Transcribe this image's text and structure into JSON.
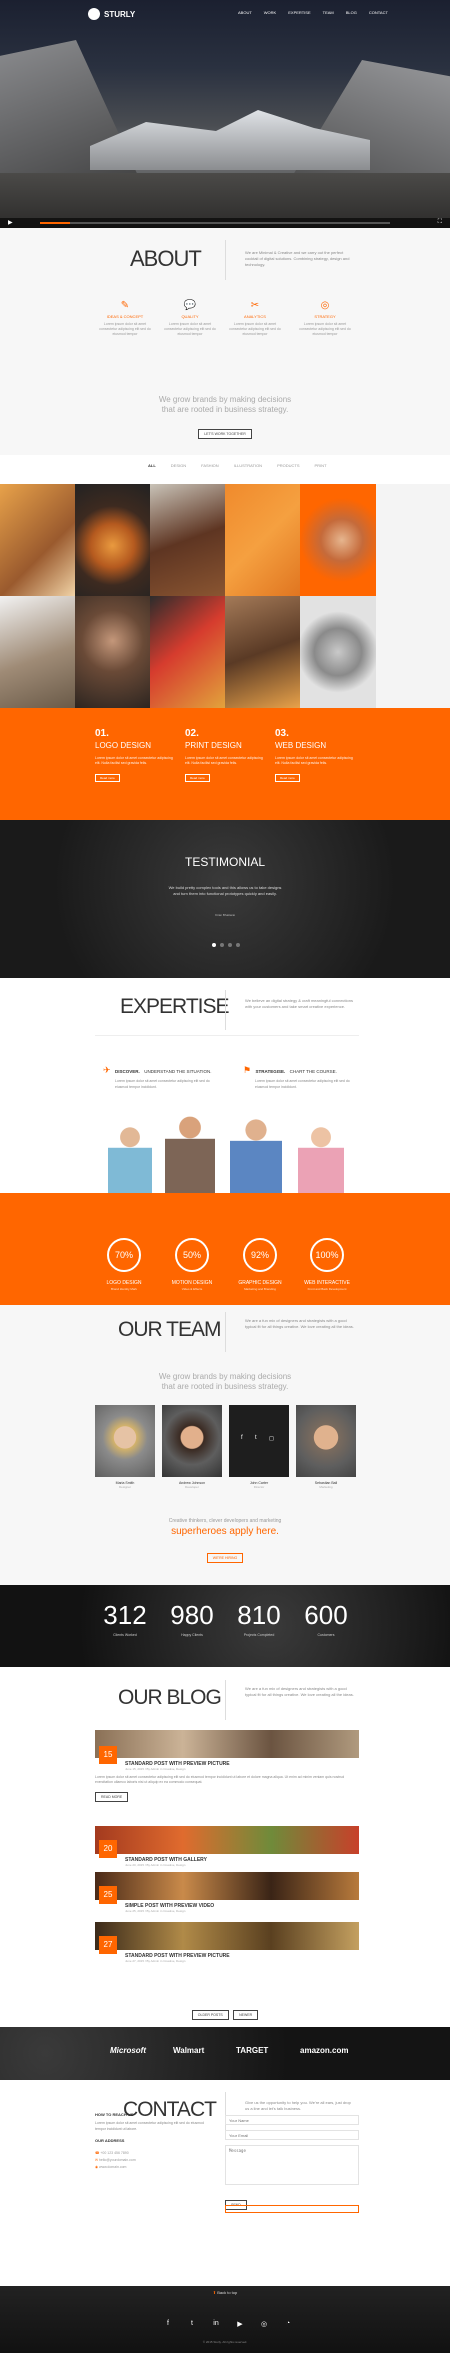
{
  "header": {
    "logo": "STURLY",
    "nav": [
      "About",
      "Work",
      "Expertise",
      "Team",
      "Blog",
      "Contact"
    ]
  },
  "about": {
    "title": "ABOUT",
    "intro": "We are Minimal & Creative and we carry out the perfect cocktail of digital solutions. Combining strategy, design and technology.",
    "features": [
      {
        "icon": "pencil-icon",
        "title": "Ideas & Concept",
        "desc": "Lorem ipsum dolor sit amet consectetur adipiscing elit sed do eiusmod tempor"
      },
      {
        "icon": "chat-icon",
        "title": "Quality",
        "desc": "Lorem ipsum dolor sit amet consectetur adipiscing elit sed do eiusmod tempor"
      },
      {
        "icon": "scissors-icon",
        "title": "Analytics",
        "desc": "Lorem ipsum dolor sit amet consectetur adipiscing elit sed do eiusmod tempor"
      },
      {
        "icon": "target-icon",
        "title": "Strategy",
        "desc": "Lorem ipsum dolor sit amet consectetur adipiscing elit sed do eiusmod tempor"
      }
    ],
    "tagline_1": "We grow brands by making decisions",
    "tagline_2": "that are rooted in business strategy.",
    "button": "Let's work together"
  },
  "portfolio": {
    "tabs": [
      "All",
      "Design",
      "Fashion",
      "Illustration",
      "Products",
      "Print"
    ]
  },
  "services": [
    {
      "num": "01.",
      "title": "LOGO DESIGN",
      "desc": "Lorem ipsum dolor sit amet consectetur adipiscing elit. Nulla facilisi sed gravida felis.",
      "btn": "Read more"
    },
    {
      "num": "02.",
      "title": "PRINT DESIGN",
      "desc": "Lorem ipsum dolor sit amet consectetur adipiscing elit. Nulla facilisi sed gravida felis.",
      "btn": "Read more"
    },
    {
      "num": "03.",
      "title": "WEB DESIGN",
      "desc": "Lorem ipsum dolor sit amet consectetur adipiscing elit. Nulla facilisi sed gravida felis.",
      "btn": "Read more"
    }
  ],
  "testimonial": {
    "title": "TESTIMONIAL",
    "quote": "We build pretty complex tools and this allows us to take designs and turn them into functional prototypes quickly and easily.",
    "author": "Kiran Bhattarai"
  },
  "expertise": {
    "title": "EXPERTISE",
    "intro": "We believe an digital strategy & craft meaningful connections with your customers and take smart creative experience.",
    "items": [
      {
        "icon": "plane-icon",
        "title": "DISCOVER.",
        "sub": "UNDERSTAND THE SITUATION.",
        "desc": "Lorem ipsum dolor sit amet consectetur adipiscing elit sed do eiusmod tempor incididunt."
      },
      {
        "icon": "flag-icon",
        "title": "STRATEGISE.",
        "sub": "CHART THE COURSE.",
        "desc": "Lorem ipsum dolor sit amet consectetur adipiscing elit sed do eiusmod tempor incididunt."
      }
    ]
  },
  "skills": [
    {
      "value": "70%",
      "title": "Logo Design",
      "desc": "Brand Identity Mark"
    },
    {
      "value": "50%",
      "title": "Motion Design",
      "desc": "Video & Effects"
    },
    {
      "value": "92%",
      "title": "Graphic Design",
      "desc": "Marketing and Branding"
    },
    {
      "value": "100%",
      "title": "Web Interactive",
      "desc": "Front and Back Development"
    }
  ],
  "team": {
    "title": "OUR TEAM",
    "intro": "We are a fun mix of designers and strategists with a good typical fit for all things creative. We love creating all the ideas.",
    "tagline_1": "We grow brands by making decisions",
    "tagline_2": "that are rooted in business strategy.",
    "members": [
      {
        "name": "Maria Smith",
        "role": "Designer"
      },
      {
        "name": "Andrew Johnson",
        "role": "Developer"
      },
      {
        "name": "John Carter",
        "role": "Director"
      },
      {
        "name": "Sebastian Ball",
        "role": "Marketing"
      }
    ],
    "hiring_1": "Creative thinkers, clever developers and marketing",
    "hiring_2": "superheroes apply here.",
    "hiring_btn": "We're hiring"
  },
  "counters": [
    {
      "value": "312",
      "label": "Clients Worked"
    },
    {
      "value": "980",
      "label": "Happy Clients"
    },
    {
      "value": "810",
      "label": "Projects Completed"
    },
    {
      "value": "600",
      "label": "Customers"
    }
  ],
  "blog": {
    "title": "OUR BLOG",
    "intro": "We are a fun mix of designers and strategists with a good typical fit for all things creative. We love creating all the ideas.",
    "posts": [
      {
        "day": "15",
        "title": "STANDARD POST WITH PREVIEW PICTURE",
        "meta": "June 15, 2015 / By Admin in Creative, Design"
      },
      {
        "day": "20",
        "title": "STANDARD POST WITH GALLERY",
        "meta": "June 20, 2015 / By Admin in Creative, Design"
      },
      {
        "day": "25",
        "title": "SIMPLE POST WITH PREVIEW VIDEO",
        "meta": "June 25, 2015 / By Admin in Creative, Design"
      },
      {
        "day": "27",
        "title": "STANDARD POST WITH PREVIEW PICTURE",
        "meta": "June 27, 2015 / By Admin in Creative, Design"
      }
    ],
    "read_more": "Read more",
    "older": "Older posts",
    "newer": "Newer"
  },
  "clients": [
    "Microsoft",
    "Walmart",
    "TARGET",
    "amazon.com"
  ],
  "contact": {
    "title": "CONTACT",
    "intro": "Give us the opportunity to help you. We're all ears, just drop us a line and let's talk business.",
    "heading": "HOW TO REACH US",
    "address_title": "OUR ADDRESS",
    "phone": "+00 123 456 7890",
    "email": "hello@yourdomain.com",
    "web": "www.domain.com",
    "placeholders": [
      "Your Name",
      "Your Email",
      "Message"
    ],
    "send": "Send",
    "back_to_top": "Back to top"
  },
  "footer": {
    "copyright": "© 2015 Sturly. All rights reserved."
  }
}
